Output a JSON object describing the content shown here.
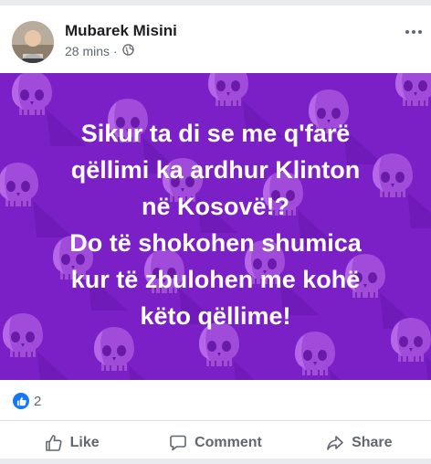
{
  "post": {
    "author": "Mubarek Misini",
    "time": "28 mins",
    "separator": "·",
    "privacy_icon": "globe-icon",
    "more_icon": "more-horizontal-icon"
  },
  "image": {
    "background_color": "#7b1fc7",
    "pattern_icon": "skull-icon",
    "lines": [
      "Sikur ta di se me q'farë",
      "qëllimi ka ardhur Klinton",
      "në Kosovë!?",
      "Do të shokohen shumica",
      "kur të zbulohen me kohë",
      "këto qëllime!"
    ]
  },
  "reactions": {
    "icon": "thumbs-up-icon",
    "count": "2",
    "badge_color": "#1877f2"
  },
  "actions": {
    "like": "Like",
    "comment": "Comment",
    "share": "Share"
  }
}
